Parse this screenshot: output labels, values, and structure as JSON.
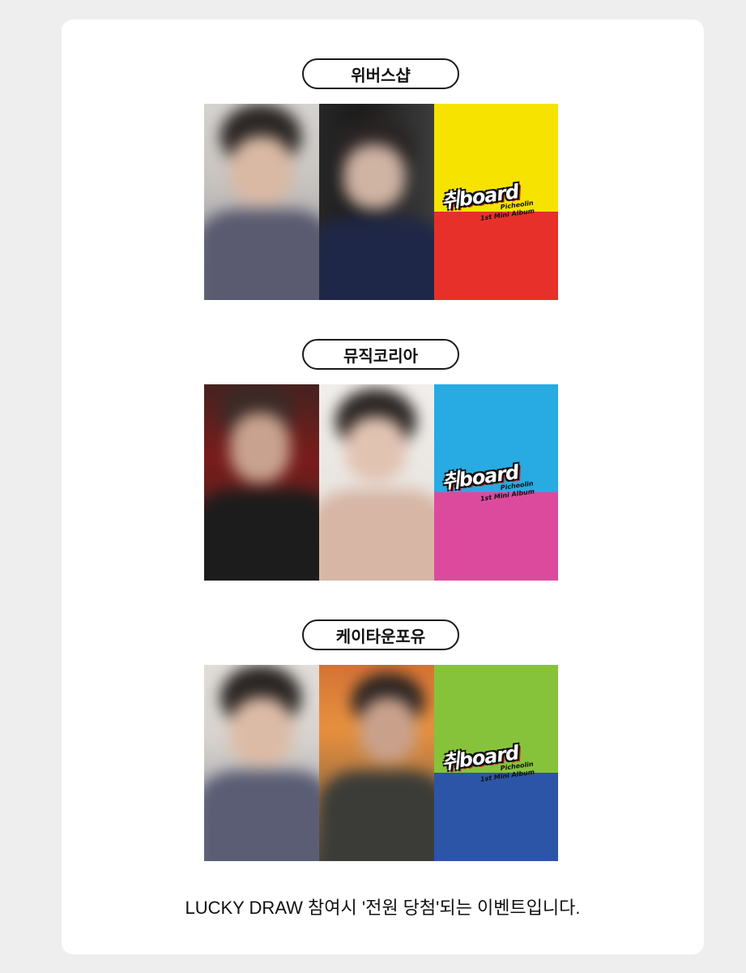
{
  "sections": [
    {
      "store": "위버스샵",
      "cover": {
        "top_color": "#f7e300",
        "bottom_color": "#e8302a"
      }
    },
    {
      "store": "뮤직코리아",
      "cover": {
        "top_color": "#27abe2",
        "bottom_color": "#dc4a9d"
      }
    },
    {
      "store": "케이타운포유",
      "cover": {
        "top_color": "#86c33a",
        "bottom_color": "#2c55a8"
      }
    }
  ],
  "album": {
    "logo": "취board",
    "artist": "Picheolin",
    "subtitle": "1st Mini Album"
  },
  "footer": "LUCKY DRAW 참여시 '전원 당첨'되는 이벤트입니다."
}
